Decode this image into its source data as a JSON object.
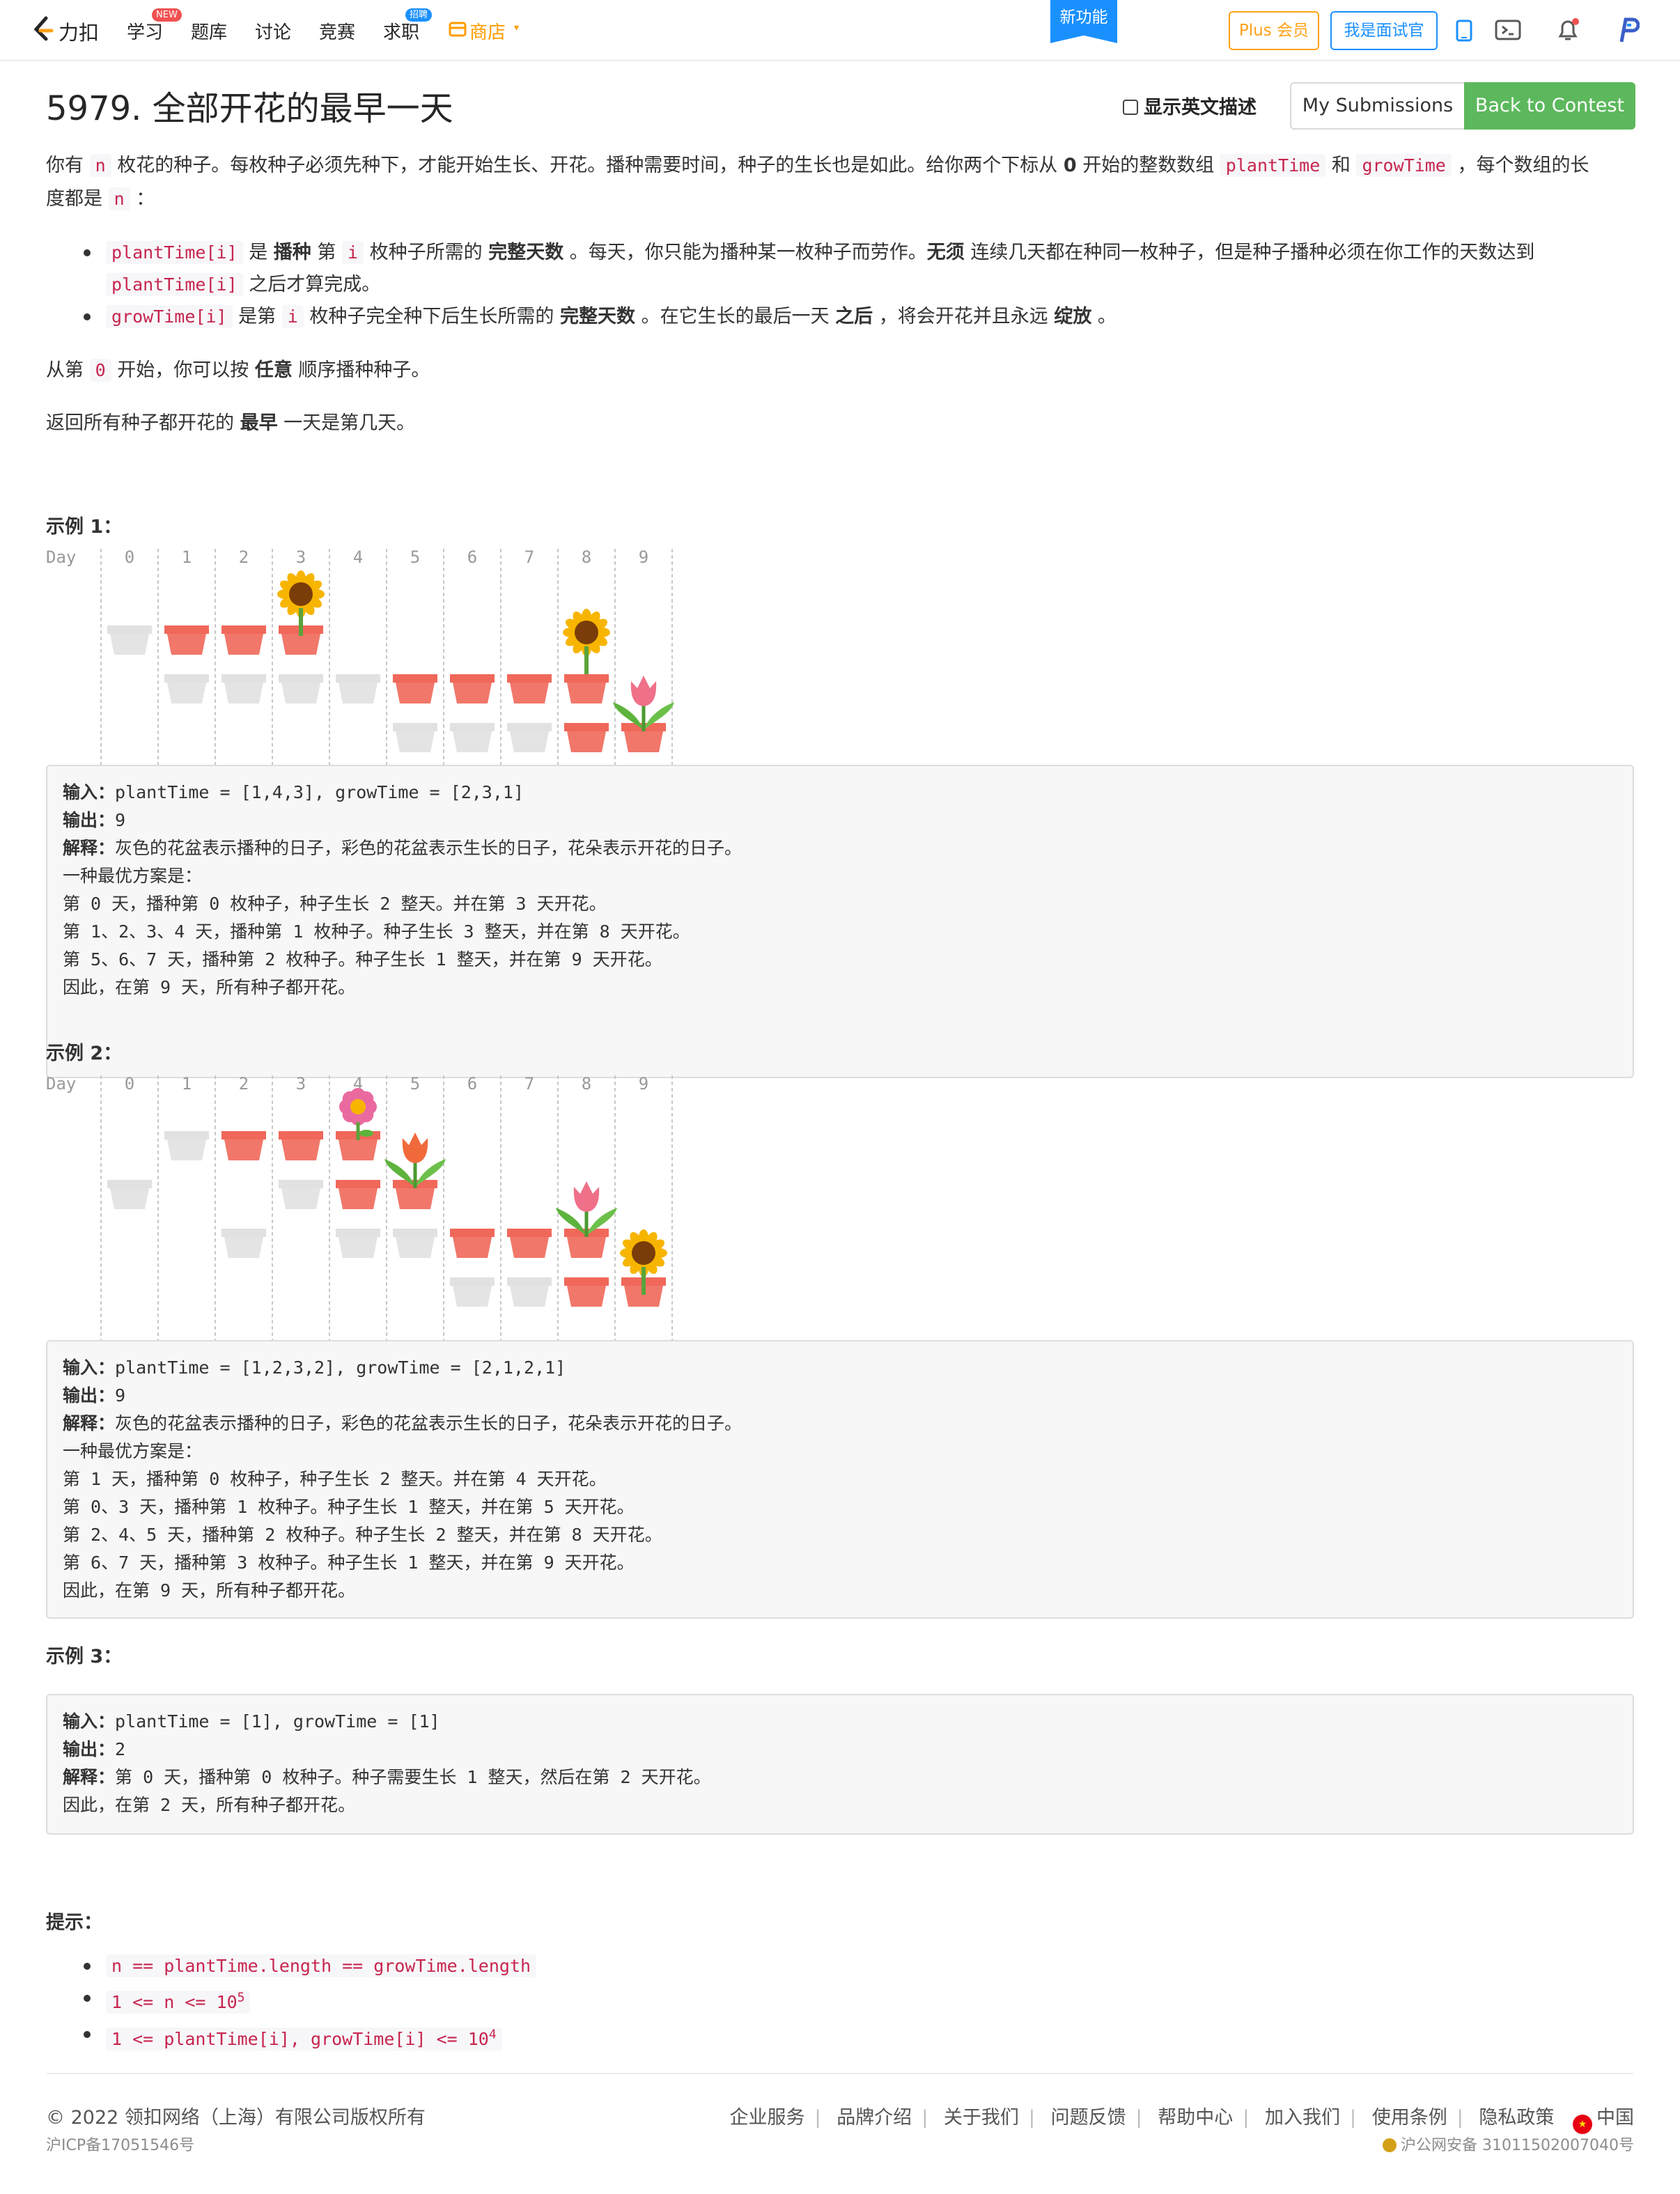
{
  "nav": {
    "logo_text": "力扣",
    "items": [
      "学习",
      "题库",
      "讨论",
      "竞赛",
      "求职",
      "商店"
    ],
    "badge_new": "NEW",
    "badge_hire": "招聘",
    "new_feature": "新功能",
    "plus": "Plus 会员",
    "interviewer": "我是面试官"
  },
  "problem": {
    "title": "5979. 全部开花的最早一天",
    "show_english": "显示英文描述",
    "my_submissions": "My Submissions",
    "back_to_contest": "Back to Contest",
    "desc1_a": "你有 ",
    "desc1_n": "n",
    "desc1_b": " 枚花的种子。每枚种子必须先种下，才能开始生长、开花。播种需要时间，种子的生长也是如此。给你两个下标从 ",
    "desc1_zero": "0",
    "desc1_c": " 开始的整数数组 ",
    "desc1_plant": "plantTime",
    "desc1_and": " 和 ",
    "desc1_grow": "growTime",
    "desc1_d": " ，每个数组的长",
    "desc2_a": "度都是 ",
    "desc2_n": "n",
    "desc2_b": " ：",
    "bullet1_code": "plantTime[i]",
    "bullet1_a": " 是 ",
    "bullet1_b": "播种",
    "bullet1_c": " 第 ",
    "bullet1_i": "i",
    "bullet1_d": " 枚种子所需的 ",
    "bullet1_e": "完整天数",
    "bullet1_f": " 。每天，你只能为播种某一枚种子而劳作。",
    "bullet1_g": "无须",
    "bullet1_h": " 连续几天都在种同一枚种子，但是种子播种必须在你工作的天数达到",
    "bullet1_code2": "plantTime[i]",
    "bullet1_j": " 之后才算完成。",
    "bullet2_code": "growTime[i]",
    "bullet2_a": " 是第 ",
    "bullet2_i": "i",
    "bullet2_b": " 枚种子完全种下后生长所需的 ",
    "bullet2_c": "完整天数",
    "bullet2_d": " 。在它生长的最后一天 ",
    "bullet2_e": "之后",
    "bullet2_f": " ，将会开花并且永远 ",
    "bullet2_g": "绽放",
    "bullet2_h": " 。",
    "p3_a": "从第 ",
    "p3_zero": "0",
    "p3_b": " 开始，你可以按 ",
    "p3_c": "任意",
    "p3_d": " 顺序播种种子。",
    "p4_a": "返回所有种子都开花的 ",
    "p4_b": "最早",
    "p4_c": " 一天是第几天。"
  },
  "diagram": {
    "day_label": "Day",
    "days": [
      "0",
      "1",
      "2",
      "3",
      "4",
      "5",
      "6",
      "7",
      "8",
      "9"
    ]
  },
  "examples": [
    {
      "title": "示例 1：",
      "input_label": "输入：",
      "input": "plantTime = [1,4,3], growTime = [2,3,1]",
      "output_label": "输出：",
      "output": "9",
      "expl_label": "解释：",
      "expl": "灰色的花盆表示播种的日子，彩色的花盆表示生长的日子，花朵表示开花的日子。",
      "lines": [
        "一种最优方案是：",
        "第 0 天，播种第 0 枚种子，种子生长 2 整天。并在第 3 天开花。",
        "第 1、2、3、4 天，播种第 1 枚种子。种子生长 3 整天，并在第 8 天开花。",
        "第 5、6、7 天，播种第 2 枚种子。种子生长 1 整天，并在第 9 天开花。",
        "因此，在第 9 天，所有种子都开花。"
      ]
    },
    {
      "title": "示例 2：",
      "input_label": "输入：",
      "input": "plantTime = [1,2,3,2], growTime = [2,1,2,1]",
      "output_label": "输出：",
      "output": "9",
      "expl_label": "解释：",
      "expl": "灰色的花盆表示播种的日子，彩色的花盆表示生长的日子，花朵表示开花的日子。",
      "lines": [
        "一种最优方案是：",
        "第 1 天，播种第 0 枚种子，种子生长 2 整天。并在第 4 天开花。",
        "第 0、3 天，播种第 1 枚种子。种子生长 1 整天，并在第 5 天开花。",
        "第 2、4、5 天，播种第 2 枚种子。种子生长 2 整天，并在第 8 天开花。",
        "第 6、7 天，播种第 3 枚种子。种子生长 1 整天，并在第 9 天开花。",
        "因此，在第 9 天，所有种子都开花。"
      ]
    },
    {
      "title": "示例 3：",
      "input_label": "输入：",
      "input": "plantTime = [1], growTime = [1]",
      "output_label": "输出：",
      "output": "2",
      "expl_label": "解释：",
      "expl": "第 0 天，播种第 0 枚种子。种子需要生长 1 整天，然后在第 2 天开花。",
      "lines": [
        "因此，在第 2 天，所有种子都开花。"
      ]
    }
  ],
  "hints": {
    "title": "提示：",
    "h1": "n == plantTime.length == growTime.length",
    "h2_base": "1 <= n <= 10",
    "h2_exp": "5",
    "h3_base": "1 <= plantTime[i], growTime[i] <= 10",
    "h3_exp": "4"
  },
  "footer": {
    "copyright": "© 2022 领扣网络（上海）有限公司版权所有",
    "icp": "沪ICP备17051546号",
    "links": [
      "企业服务",
      "品牌介绍",
      "关于我们",
      "问题反馈",
      "帮助中心",
      "加入我们",
      "使用条例",
      "隐私政策"
    ],
    "region": "中国",
    "police": "沪公网安备 31011502007040号"
  },
  "colors": {
    "accent": "#1a90ff",
    "green": "#5cb85c",
    "pot_red": "#f0685a",
    "pot_gray": "#e1e1e1",
    "code_red": "#c7254e",
    "shop": "#ff9c00"
  }
}
